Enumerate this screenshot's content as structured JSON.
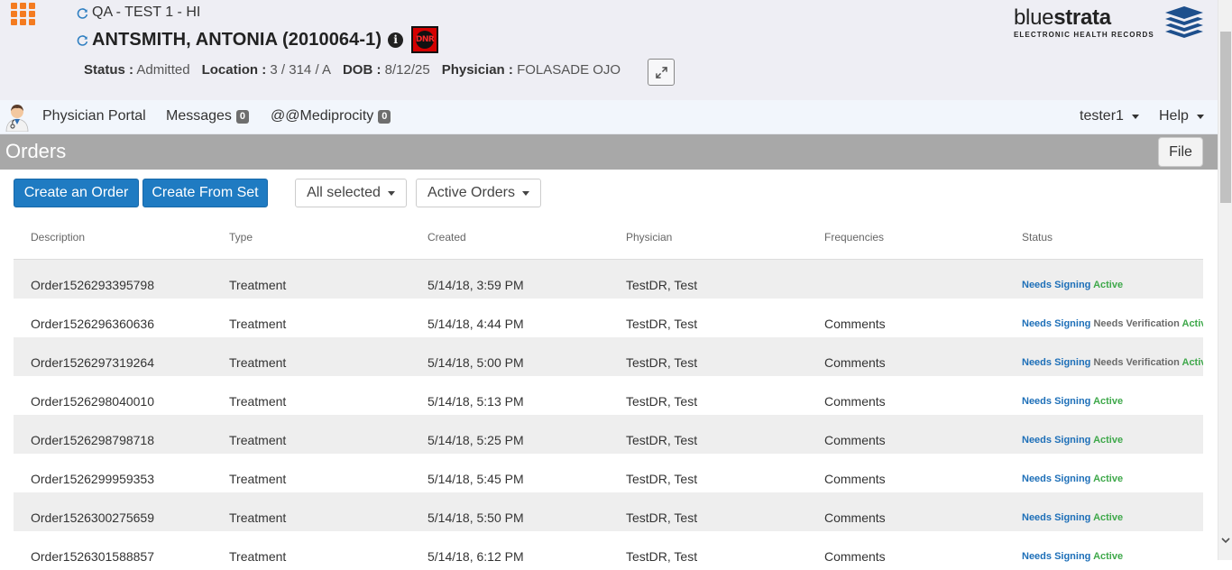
{
  "header": {
    "facility": "QA - TEST 1 - HI",
    "patient_name": "ANTSMITH, ANTONIA (2010064-1)",
    "dnr_label": "DNR",
    "status_label": "Status :",
    "status_value": "Admitted",
    "location_label": "Location :",
    "location_value": "3 / 314 / A",
    "dob_label": "DOB :",
    "dob_value": "8/12/25",
    "physician_label": "Physician :",
    "physician_value": "FOLASADE OJO"
  },
  "brand": {
    "name_light": "blue",
    "name_bold": "strata",
    "subtitle": "ELECTRONIC HEALTH RECORDS",
    "color": "#1d4f8c"
  },
  "nav": {
    "portal": "Physician Portal",
    "messages": "Messages",
    "messages_count": "0",
    "mediprocity": "@@Mediprocity",
    "mediprocity_count": "0",
    "user": "tester1",
    "help": "Help"
  },
  "orders": {
    "title": "Orders",
    "file_button": "File",
    "create_order": "Create an Order",
    "create_from_set": "Create From Set",
    "filter_selected": "All selected",
    "filter_orders": "Active Orders"
  },
  "table": {
    "columns": [
      "Description",
      "Type",
      "Created",
      "Physician",
      "Frequencies",
      "Status"
    ],
    "rows": [
      {
        "description": "Order1526293395798",
        "type": "Treatment",
        "created": "5/14/18, 3:59 PM",
        "physician": "TestDR, Test",
        "frequencies": "",
        "status": [
          "Needs Signing",
          "Active"
        ]
      },
      {
        "description": "Order1526296360636",
        "type": "Treatment",
        "created": "5/14/18, 4:44 PM",
        "physician": "TestDR, Test",
        "frequencies": "Comments",
        "status": [
          "Needs Signing",
          "Needs Verification",
          "Active"
        ]
      },
      {
        "description": "Order1526297319264",
        "type": "Treatment",
        "created": "5/14/18, 5:00 PM",
        "physician": "TestDR, Test",
        "frequencies": "Comments",
        "status": [
          "Needs Signing",
          "Needs Verification",
          "Active"
        ]
      },
      {
        "description": "Order1526298040010",
        "type": "Treatment",
        "created": "5/14/18, 5:13 PM",
        "physician": "TestDR, Test",
        "frequencies": "Comments",
        "status": [
          "Needs Signing",
          "Active"
        ]
      },
      {
        "description": "Order1526298798718",
        "type": "Treatment",
        "created": "5/14/18, 5:25 PM",
        "physician": "TestDR, Test",
        "frequencies": "Comments",
        "status": [
          "Needs Signing",
          "Active"
        ]
      },
      {
        "description": "Order1526299959353",
        "type": "Treatment",
        "created": "5/14/18, 5:45 PM",
        "physician": "TestDR, Test",
        "frequencies": "Comments",
        "status": [
          "Needs Signing",
          "Active"
        ]
      },
      {
        "description": "Order1526300275659",
        "type": "Treatment",
        "created": "5/14/18, 5:50 PM",
        "physician": "TestDR, Test",
        "frequencies": "Comments",
        "status": [
          "Needs Signing",
          "Active"
        ]
      },
      {
        "description": "Order1526301588857",
        "type": "Treatment",
        "created": "5/14/18, 6:12 PM",
        "physician": "TestDR, Test",
        "frequencies": "Comments",
        "status": [
          "Needs Signing",
          "Active"
        ]
      }
    ]
  },
  "colors": {
    "accent_orange": "#f47b20",
    "primary_blue": "#1f7bc2",
    "status_needs_signing": "#1d6fb8",
    "status_needs_verification": "#6a6a6a",
    "status_active": "#3ea84a",
    "orders_bar": "#a8a8a8"
  }
}
